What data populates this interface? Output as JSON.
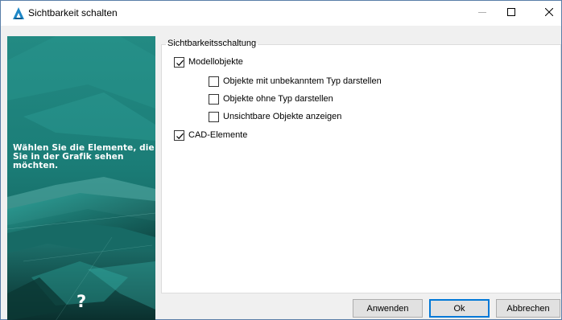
{
  "window": {
    "title": "Sichtbarkeit schalten",
    "icon": "app-logo-icon",
    "controls": {
      "minimize": "minimize-icon",
      "maximize": "maximize-icon",
      "close": "close-icon"
    }
  },
  "side_panel": {
    "text": "Wählen Sie die Elemente, die Sie in der Grafik sehen möchten.",
    "help": "?"
  },
  "group": {
    "label": "Sichtbarkeitsschaltung",
    "options": [
      {
        "label": "Modellobjekte",
        "checked": true
      },
      {
        "label": "Objekte mit unbekanntem Typ darstellen",
        "checked": false
      },
      {
        "label": "Objekte ohne Typ darstellen",
        "checked": false
      },
      {
        "label": "Unsichtbare Objekte anzeigen",
        "checked": false
      },
      {
        "label": "CAD-Elemente",
        "checked": true
      }
    ]
  },
  "buttons": {
    "apply": "Anwenden",
    "ok": "Ok",
    "cancel": "Abbrechen"
  },
  "colors": {
    "panel_teal": "#1f8c85",
    "panel_dark": "#0f5c57",
    "accent": "#0078d7"
  }
}
